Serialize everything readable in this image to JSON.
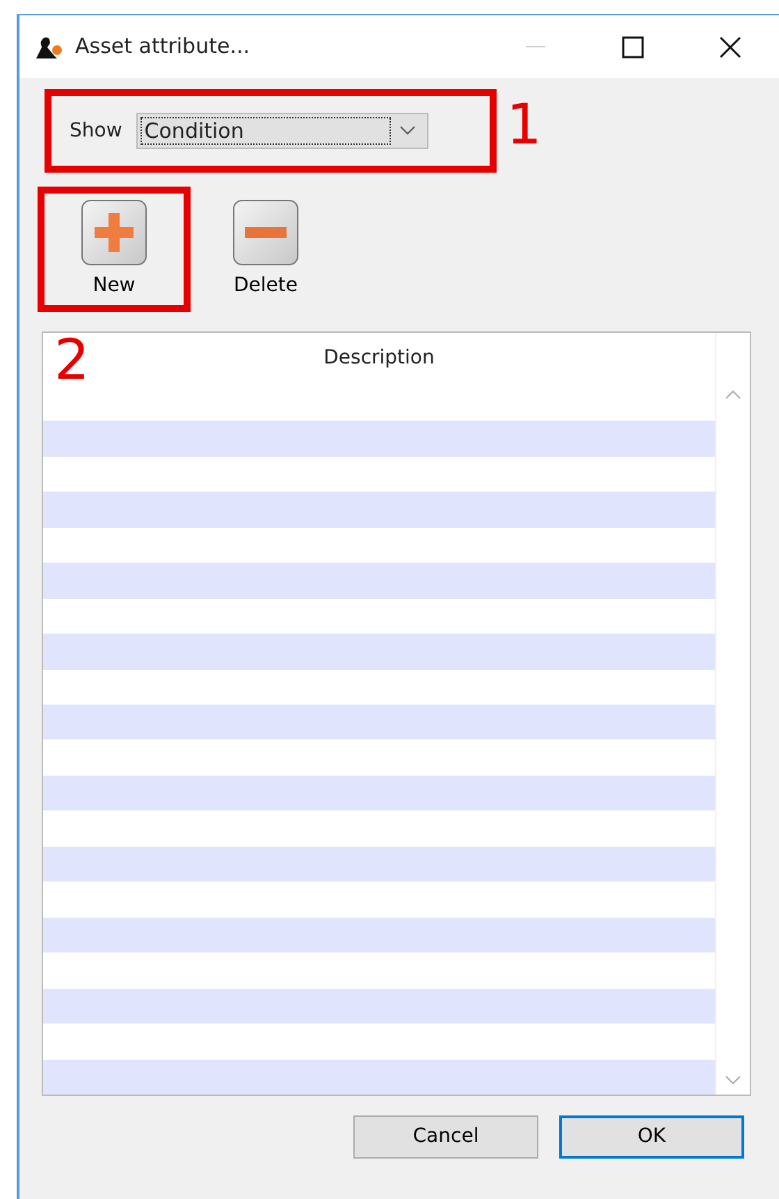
{
  "window": {
    "title": "Asset attribute..."
  },
  "show": {
    "label": "Show",
    "value": "Condition"
  },
  "toolbar": [
    {
      "kind": "add",
      "label": "New"
    },
    {
      "kind": "remove",
      "label": "Delete"
    }
  ],
  "table": {
    "columns": [
      "Description"
    ]
  },
  "buttons": [
    {
      "label": "Cancel",
      "default": false
    },
    {
      "label": "OK",
      "default": true
    }
  ],
  "annotations": [
    {
      "label": "1"
    },
    {
      "label": "2"
    }
  ]
}
